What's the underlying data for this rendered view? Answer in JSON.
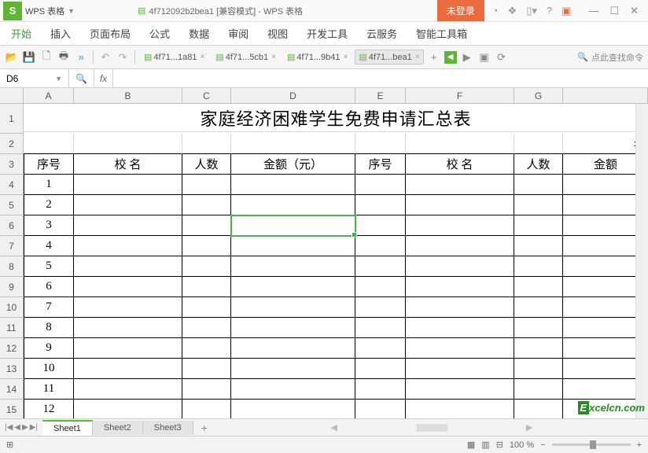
{
  "title_bar": {
    "wps_logo": "S",
    "app_name": "WPS 表格",
    "doc_title": "4f712092b2bea1 [兼容模式] - WPS 表格",
    "login_label": "未登录"
  },
  "menu": {
    "items": [
      "开始",
      "插入",
      "页面布局",
      "公式",
      "数据",
      "审阅",
      "视图",
      "开发工具",
      "云服务",
      "智能工具箱"
    ],
    "active_index": 0
  },
  "toolbar": {
    "doc_tabs": [
      {
        "label": "4f71...1a81",
        "active": false
      },
      {
        "label": "4f71...5cb1",
        "active": false
      },
      {
        "label": "4f71...9b41",
        "active": false
      },
      {
        "label": "4f71...bea1",
        "active": true
      }
    ],
    "search_placeholder": "点此查找命令"
  },
  "formula_bar": {
    "name_box": "D6",
    "fx": "fx",
    "value": ""
  },
  "sheet": {
    "columns": [
      "A",
      "B",
      "C",
      "D",
      "E",
      "F",
      "G"
    ],
    "col_widths": [
      "cA",
      "cB",
      "cC",
      "cD",
      "cE",
      "cF",
      "cG",
      "cH"
    ],
    "title": "家庭经济困难学生免费申请汇总表",
    "row2_right": "年",
    "headers_left": [
      "序号",
      "校 名",
      "人数",
      "金额（元）"
    ],
    "headers_right": [
      "序号",
      "校 名",
      "人数",
      "金额"
    ],
    "numbers": [
      "1",
      "2",
      "3",
      "4",
      "5",
      "6",
      "7",
      "8",
      "9",
      "10",
      "11",
      "12"
    ],
    "selected": {
      "row": 6,
      "col": "D"
    }
  },
  "sheet_tabs": {
    "tabs": [
      "Sheet1",
      "Sheet2",
      "Sheet3"
    ],
    "active_index": 0
  },
  "status_bar": {
    "zoom": "100 %"
  },
  "watermark": {
    "e": "E",
    "rest": "xcelcn.com"
  }
}
